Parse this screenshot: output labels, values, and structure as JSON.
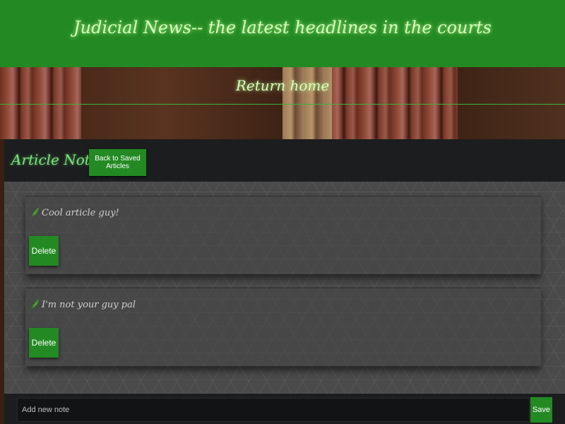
{
  "header": {
    "title": "Judicial News-- the latest headlines in the courts"
  },
  "nav": {
    "return_home": "Return home"
  },
  "panel": {
    "title": "Article Notes:",
    "back_button_label": "Back to Saved Articles"
  },
  "notes": [
    {
      "text": "Cool article guy!",
      "delete_label": "Delete"
    },
    {
      "text": "I'm not your guy pal",
      "delete_label": "Delete"
    }
  ],
  "new_note": {
    "placeholder": "Add new note",
    "save_label": "Save"
  },
  "colors": {
    "brand_green": "#238a23",
    "title_glow": "#d9ffbf",
    "panel_title": "#7fe07f",
    "panel_bg": "#1e1f21"
  },
  "icons": {
    "note_icon": "leaf-icon"
  }
}
